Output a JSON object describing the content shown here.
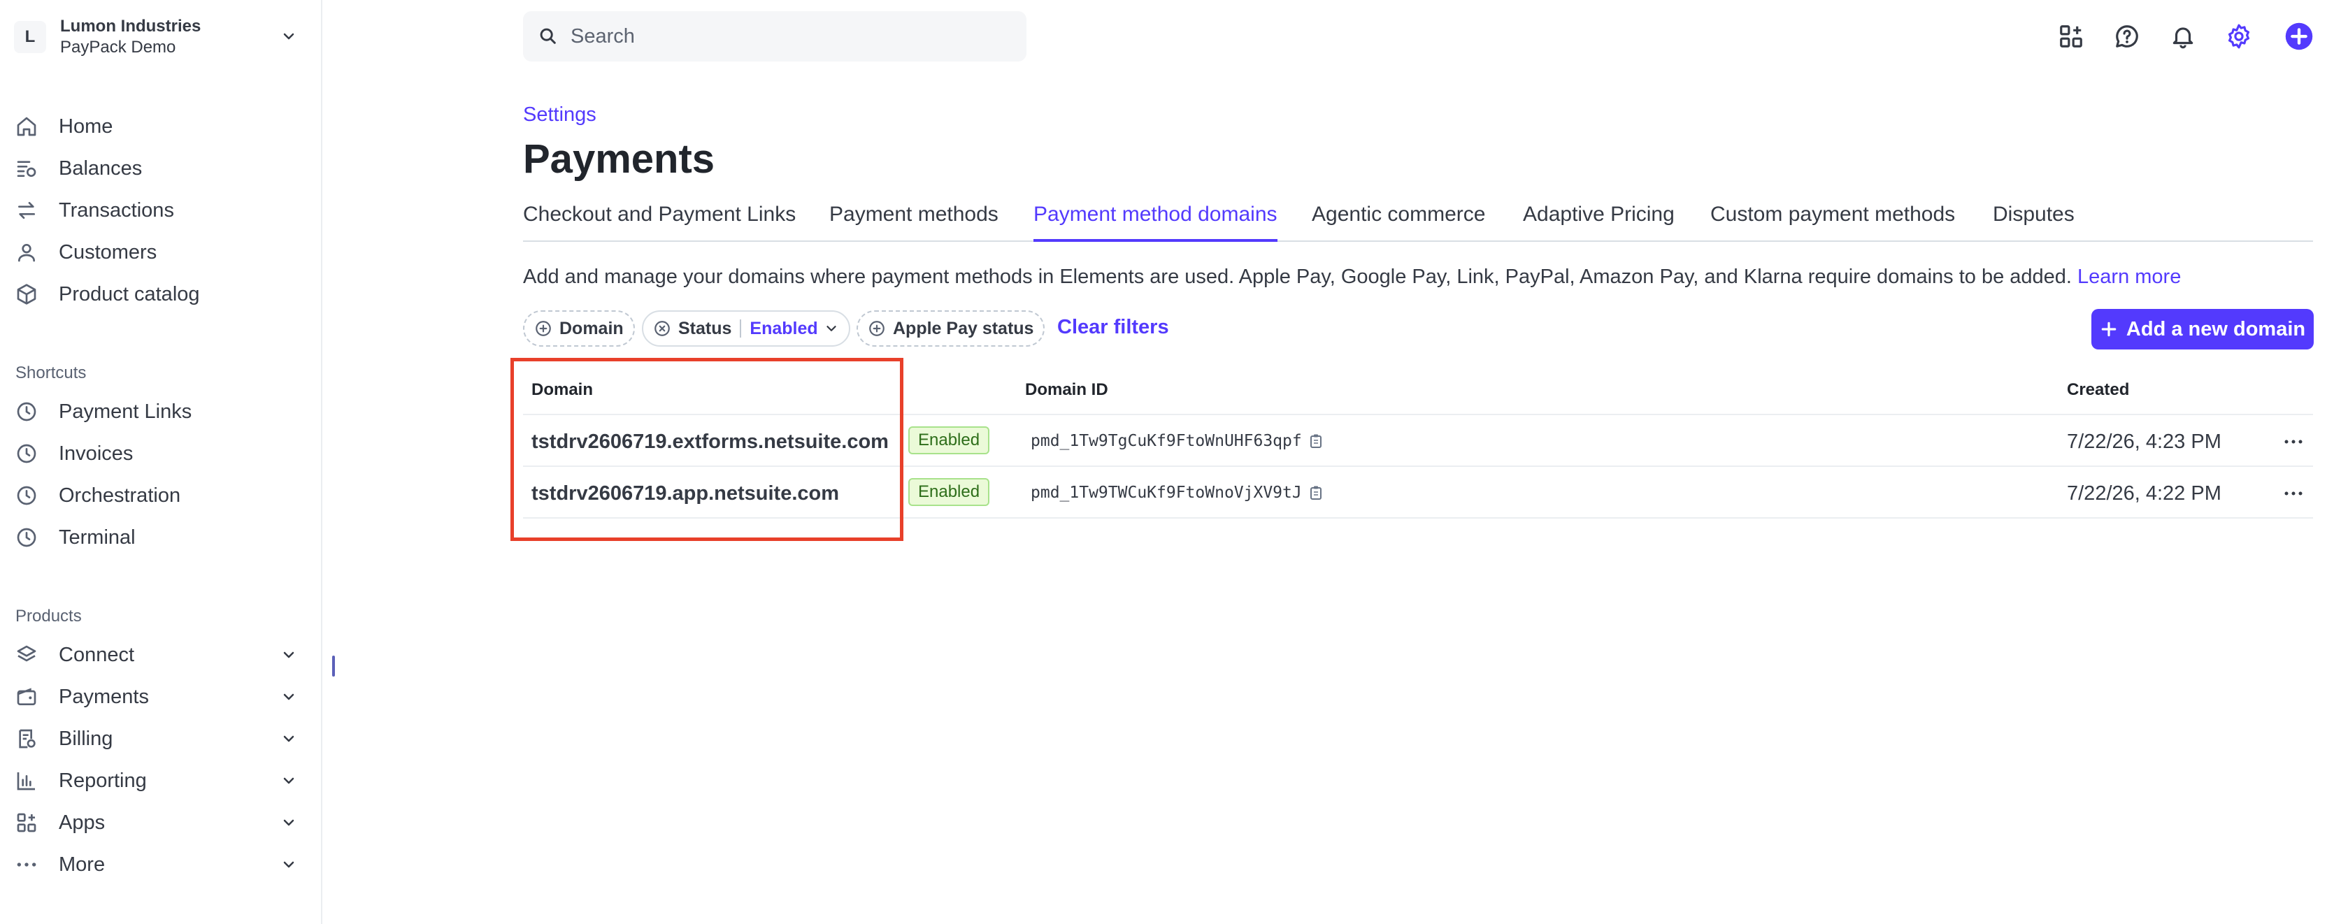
{
  "account": {
    "initial": "L",
    "name": "Lumon Industries",
    "subtitle": "PayPack Demo"
  },
  "sidebar": {
    "main_items": [
      {
        "label": "Home",
        "icon": "home-icon"
      },
      {
        "label": "Balances",
        "icon": "balances-icon"
      },
      {
        "label": "Transactions",
        "icon": "transactions-icon"
      },
      {
        "label": "Customers",
        "icon": "customers-icon"
      },
      {
        "label": "Product catalog",
        "icon": "product-catalog-icon"
      }
    ],
    "shortcuts_title": "Shortcuts",
    "shortcuts": [
      {
        "label": "Payment Links",
        "icon": "clock-icon"
      },
      {
        "label": "Invoices",
        "icon": "clock-icon"
      },
      {
        "label": "Orchestration",
        "icon": "clock-icon"
      },
      {
        "label": "Terminal",
        "icon": "clock-icon"
      }
    ],
    "products_title": "Products",
    "products": [
      {
        "label": "Connect",
        "icon": "connect-icon"
      },
      {
        "label": "Payments",
        "icon": "wallet-icon"
      },
      {
        "label": "Billing",
        "icon": "billing-icon"
      },
      {
        "label": "Reporting",
        "icon": "reporting-icon"
      },
      {
        "label": "Apps",
        "icon": "apps-icon"
      },
      {
        "label": "More",
        "icon": "more-dots-icon"
      }
    ]
  },
  "search": {
    "placeholder": "Search"
  },
  "topbar_icons": [
    "apps-grid-icon",
    "help-icon",
    "bell-icon",
    "gear-icon",
    "plus-circle-icon"
  ],
  "breadcrumb": "Settings",
  "page_title": "Payments",
  "tabs": [
    {
      "label": "Checkout and Payment Links",
      "active": false
    },
    {
      "label": "Payment methods",
      "active": false
    },
    {
      "label": "Payment method domains",
      "active": true
    },
    {
      "label": "Agentic commerce",
      "active": false
    },
    {
      "label": "Adaptive Pricing",
      "active": false
    },
    {
      "label": "Custom payment methods",
      "active": false
    },
    {
      "label": "Disputes",
      "active": false
    }
  ],
  "description": {
    "text": "Add and manage your domains where payment methods in Elements are used. Apple Pay, Google Pay, Link, PayPal, Amazon Pay, and Klarna require domains to be added. ",
    "link": "Learn more"
  },
  "filters": {
    "domain": "Domain",
    "status_label": "Status",
    "status_value": "Enabled",
    "apple_pay": "Apple Pay status",
    "clear": "Clear filters"
  },
  "add_button": "Add a new domain",
  "table": {
    "headers": {
      "domain": "Domain",
      "domain_id": "Domain ID",
      "created": "Created"
    },
    "rows": [
      {
        "domain": "tstdrv2606719.extforms.netsuite.com",
        "status": "Enabled",
        "domain_id": "pmd_1Tw9TgCuKf9FtoWnUHF63qpf",
        "created": "7/22/26, 4:23 PM"
      },
      {
        "domain": "tstdrv2606719.app.netsuite.com",
        "status": "Enabled",
        "domain_id": "pmd_1Tw9TWCuKf9FtoWnoVjXV9tJ",
        "created": "7/22/26, 4:22 PM"
      }
    ]
  },
  "colors": {
    "accent": "#533afd",
    "highlight": "#e8402a",
    "badge_bg": "#ebfad8",
    "badge_text": "#2e6e1a"
  }
}
